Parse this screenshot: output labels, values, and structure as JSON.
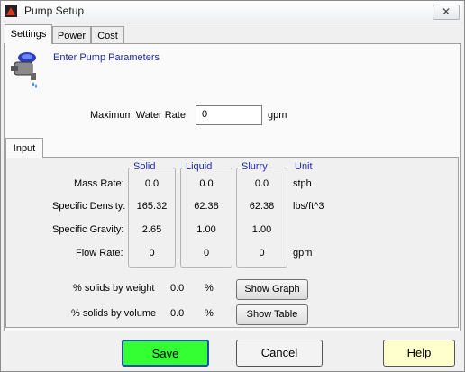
{
  "window": {
    "title": "Pump Setup",
    "close_glyph": "✕"
  },
  "tabs": [
    "Settings",
    "Power",
    "Cost"
  ],
  "header": {
    "text": "Enter Pump Parameters",
    "icon": "pump-icon"
  },
  "max_water_rate": {
    "label": "Maximum Water Rate:",
    "value": "0",
    "unit": "gpm"
  },
  "input_tab": "Input",
  "columns": {
    "solid": "Solid",
    "liquid": "Liquid",
    "slurry": "Slurry",
    "unit": "Unit"
  },
  "rows": [
    {
      "label": "Mass Rate:",
      "solid": "0.0",
      "liquid": "0.0",
      "slurry": "0.0",
      "unit": "stph"
    },
    {
      "label": "Specific Density:",
      "solid": "165.32",
      "liquid": "62.38",
      "slurry": "62.38",
      "unit": "lbs/ft^3"
    },
    {
      "label": "Specific Gravity:",
      "solid": "2.65",
      "liquid": "1.00",
      "slurry": "1.00",
      "unit": ""
    },
    {
      "label": "Flow Rate:",
      "solid": "0",
      "liquid": "0",
      "slurry": "0",
      "unit": "gpm"
    }
  ],
  "percent": [
    {
      "label": "% solids by weight",
      "value": "0.0",
      "unit": "%",
      "button": "Show Graph"
    },
    {
      "label": "% solids by volume",
      "value": "0.0",
      "unit": "%",
      "button": "Show Table"
    }
  ],
  "buttons": {
    "save": "Save",
    "cancel": "Cancel",
    "help": "Help"
  },
  "colors": {
    "save_bg": "#33ff33",
    "help_bg": "#ffffcc",
    "accent_text": "#1f2aa8"
  }
}
